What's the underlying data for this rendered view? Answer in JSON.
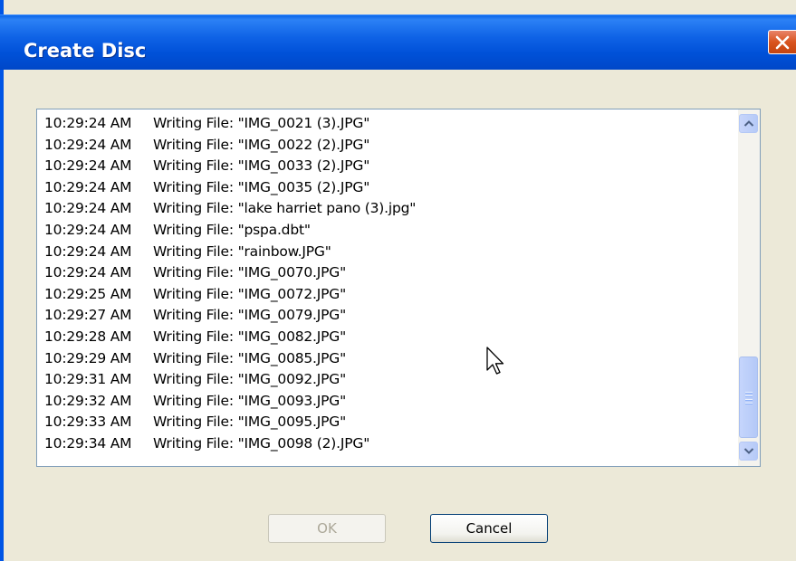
{
  "window": {
    "title": "Create Disc"
  },
  "log": {
    "entries": [
      {
        "time": "10:29:24 AM",
        "message": "Writing File: \"IMG_0021 (3).JPG\""
      },
      {
        "time": "10:29:24 AM",
        "message": "Writing File: \"IMG_0022 (2).JPG\""
      },
      {
        "time": "10:29:24 AM",
        "message": "Writing File: \"IMG_0033 (2).JPG\""
      },
      {
        "time": "10:29:24 AM",
        "message": "Writing File: \"IMG_0035 (2).JPG\""
      },
      {
        "time": "10:29:24 AM",
        "message": "Writing File: \"lake harriet pano (3).jpg\""
      },
      {
        "time": "10:29:24 AM",
        "message": "Writing File: \"pspa.dbt\""
      },
      {
        "time": "10:29:24 AM",
        "message": "Writing File: \"rainbow.JPG\""
      },
      {
        "time": "10:29:24 AM",
        "message": "Writing File: \"IMG_0070.JPG\""
      },
      {
        "time": "10:29:25 AM",
        "message": "Writing File: \"IMG_0072.JPG\""
      },
      {
        "time": "10:29:27 AM",
        "message": "Writing File: \"IMG_0079.JPG\""
      },
      {
        "time": "10:29:28 AM",
        "message": "Writing File: \"IMG_0082.JPG\""
      },
      {
        "time": "10:29:29 AM",
        "message": "Writing File: \"IMG_0085.JPG\""
      },
      {
        "time": "10:29:31 AM",
        "message": "Writing File: \"IMG_0092.JPG\""
      },
      {
        "time": "10:29:32 AM",
        "message": "Writing File: \"IMG_0093.JPG\""
      },
      {
        "time": "10:29:33 AM",
        "message": "Writing File: \"IMG_0095.JPG\""
      },
      {
        "time": "10:29:34 AM",
        "message": "Writing File: \"IMG_0098 (2).JPG\""
      }
    ]
  },
  "buttons": {
    "ok_label": "OK",
    "cancel_label": "Cancel",
    "ok_enabled": false
  },
  "icons": {
    "close": "close-icon",
    "scroll_up": "chevron-up-icon",
    "scroll_down": "chevron-down-icon",
    "cursor": "mouse-pointer-icon"
  },
  "colors": {
    "titlebar": "#0055E5",
    "dialog_bg": "#ECE9D8",
    "close_button": "#D9541F"
  }
}
